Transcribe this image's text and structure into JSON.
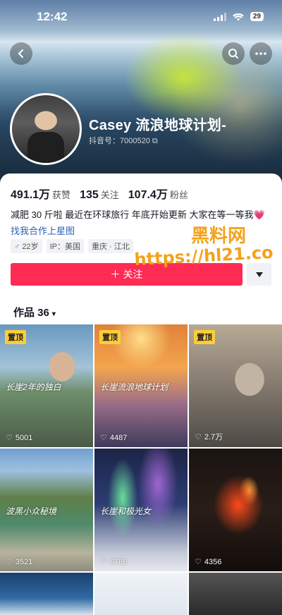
{
  "status": {
    "time": "12:42",
    "battery": "29"
  },
  "profile": {
    "name": "Casey 流浪地球计划-",
    "douyin_id": "抖音号：7000520",
    "stats": [
      {
        "value": "491.1万",
        "label": "获赞"
      },
      {
        "value": "135",
        "label": "关注"
      },
      {
        "value": "107.4万",
        "label": "粉丝"
      }
    ],
    "bio": "减肥 30 斤啦 最近在环球旅行 年底开始更新 大家在等一等我",
    "bio_emoji": "💗",
    "link": "找我合作上星图",
    "tags": {
      "gender_icon": "♂",
      "age": "22岁",
      "ip": "IP：美国",
      "location": "重庆 · 江北"
    }
  },
  "watermark": {
    "line1": "黑料网",
    "line2": "https://hl21.co"
  },
  "actions": {
    "follow": "＋ 关注",
    "dropdown_icon": "triangle-down-icon"
  },
  "works": {
    "label": "作品 36",
    "chevron": "▾"
  },
  "videos": [
    {
      "pinned": true,
      "pin_label": "置顶",
      "likes": "5001",
      "caption": "长崖2年的独白"
    },
    {
      "pinned": true,
      "pin_label": "置顶",
      "likes": "4487",
      "caption": "长崖流浪地球计划"
    },
    {
      "pinned": true,
      "pin_label": "置顶",
      "likes": "2.7万",
      "caption": ""
    },
    {
      "pinned": false,
      "pin_label": "",
      "likes": "3521",
      "caption": "波黑小众秘境"
    },
    {
      "pinned": false,
      "pin_label": "",
      "likes": "6786",
      "caption": "长崖和极光女"
    },
    {
      "pinned": false,
      "pin_label": "",
      "likes": "4356",
      "caption": ""
    }
  ]
}
